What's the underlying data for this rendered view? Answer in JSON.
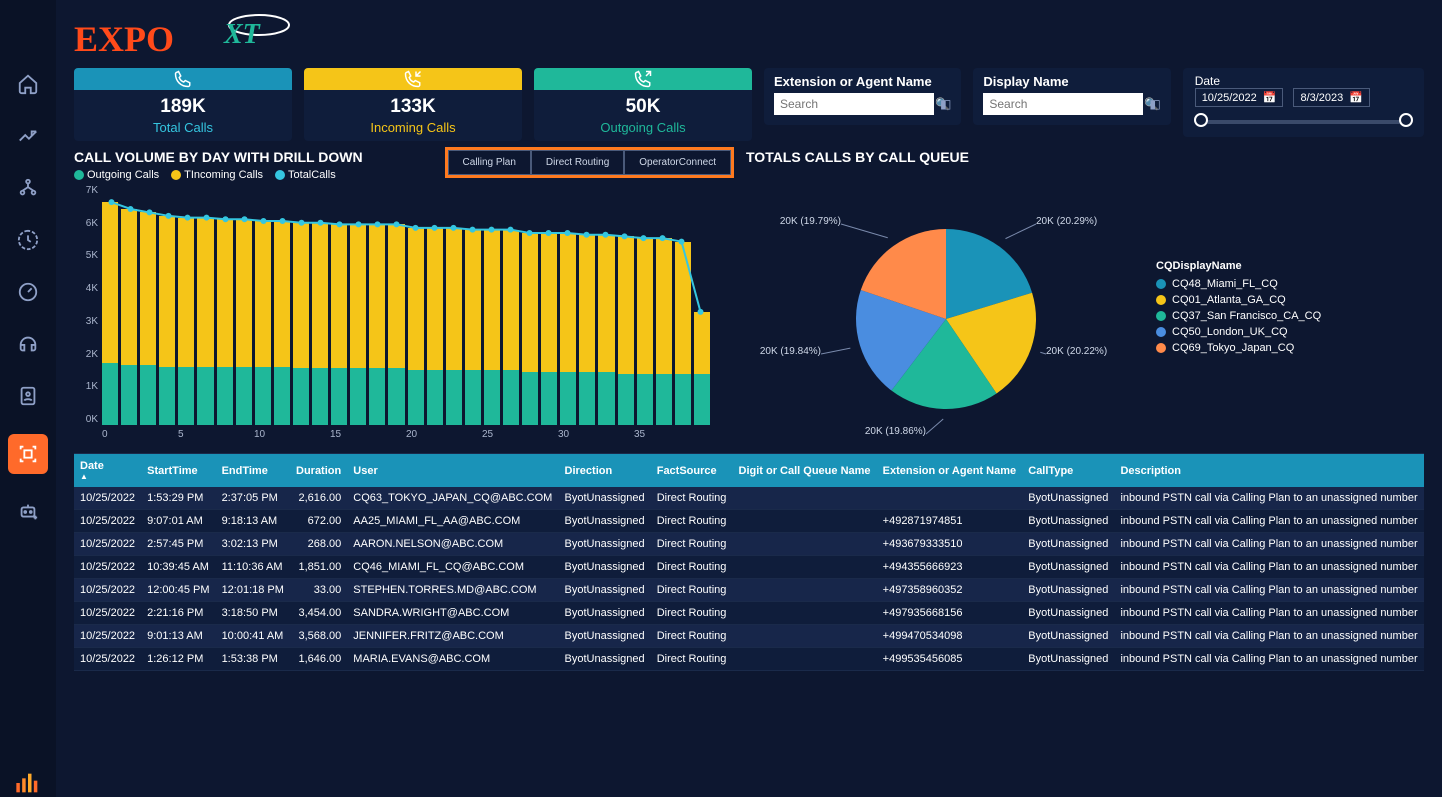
{
  "logo": {
    "text1": "EXPO",
    "text2": "XT"
  },
  "nav_items": [
    "home",
    "trend",
    "org",
    "time",
    "gauge",
    "headset",
    "contact",
    "scan",
    "bot-add"
  ],
  "kpis": [
    {
      "value": "189K",
      "label": "Total Calls",
      "color_bar": "#1a93b8",
      "color_lbl": "#35c6e0",
      "icon": "phone"
    },
    {
      "value": "133K",
      "label": "Incoming Calls",
      "color_bar": "#f5c518",
      "color_lbl": "#f5c518",
      "icon": "phone-in"
    },
    {
      "value": "50K",
      "label": "Outgoing Calls",
      "color_bar": "#1fb89a",
      "color_lbl": "#1fb89a",
      "icon": "phone-out"
    }
  ],
  "filters": {
    "ext": {
      "label": "Extension or Agent Name",
      "placeholder": "Search"
    },
    "disp": {
      "label": "Display Name",
      "placeholder": "Search"
    },
    "date": {
      "label": "Date",
      "from": "10/25/2022",
      "to": "8/3/2023"
    }
  },
  "bar_panel": {
    "title": "CALL VOLUME BY DAY WITH DRILL DOWN",
    "tabs": [
      "Calling Plan",
      "Direct Routing",
      "OperatorConnect"
    ],
    "legend": [
      {
        "name": "Outgoing Calls",
        "color": "#1fb89a"
      },
      {
        "name": "TIncoming Calls",
        "color": "#f5c518"
      },
      {
        "name": "TotalCalls",
        "color": "#35c6e0"
      }
    ],
    "y_ticks": [
      "7K",
      "6K",
      "5K",
      "4K",
      "3K",
      "2K",
      "1K",
      "0K"
    ],
    "x_ticks": [
      "0",
      "5",
      "10",
      "15",
      "20",
      "25",
      "30",
      "35"
    ]
  },
  "chart_data": {
    "type": "bar",
    "title": "CALL VOLUME BY DAY WITH DRILL DOWN",
    "xlabel": "",
    "ylabel": "",
    "ylim": [
      0,
      7000
    ],
    "x": [
      1,
      2,
      3,
      4,
      5,
      6,
      7,
      8,
      9,
      10,
      11,
      12,
      13,
      14,
      15,
      16,
      17,
      18,
      19,
      20,
      21,
      22,
      23,
      24,
      25,
      26,
      27,
      28,
      29,
      30,
      31,
      32
    ],
    "series": [
      {
        "name": "Outgoing Calls",
        "type": "bar",
        "color": "#1fb89a",
        "values": [
          1800,
          1750,
          1750,
          1700,
          1700,
          1700,
          1700,
          1700,
          1700,
          1700,
          1650,
          1650,
          1650,
          1650,
          1650,
          1650,
          1600,
          1600,
          1600,
          1600,
          1600,
          1600,
          1550,
          1550,
          1550,
          1550,
          1550,
          1500,
          1500,
          1500,
          1500,
          1500
        ]
      },
      {
        "name": "TIncoming Calls",
        "type": "bar",
        "color": "#f5c518",
        "values": [
          4700,
          4550,
          4450,
          4400,
          4350,
          4350,
          4300,
          4300,
          4250,
          4250,
          4250,
          4250,
          4200,
          4200,
          4200,
          4200,
          4150,
          4150,
          4150,
          4100,
          4100,
          4100,
          4050,
          4050,
          4050,
          4000,
          4000,
          4000,
          3950,
          3950,
          3850,
          1800
        ]
      },
      {
        "name": "TotalCalls",
        "type": "line",
        "color": "#35c6e0",
        "values": [
          6500,
          6300,
          6200,
          6100,
          6050,
          6050,
          6000,
          6000,
          5950,
          5950,
          5900,
          5900,
          5850,
          5850,
          5850,
          5850,
          5750,
          5750,
          5750,
          5700,
          5700,
          5700,
          5600,
          5600,
          5600,
          5550,
          5550,
          5500,
          5450,
          5450,
          5350,
          3300
        ]
      }
    ]
  },
  "pie_panel": {
    "title": "TOTALS CALLS BY CALL QUEUE",
    "legend_title": "CQDisplayName",
    "slices": [
      {
        "name": "CQ48_Miami_FL_CQ",
        "label": "20K (20.29%)",
        "pct": 20.29,
        "color": "#1a93b8"
      },
      {
        "name": "CQ01_Atlanta_GA_CQ",
        "label": "20K (20.22%)",
        "pct": 20.22,
        "color": "#f5c518"
      },
      {
        "name": "CQ37_San Francisco_CA_CQ",
        "label": "20K (19.86%)",
        "pct": 19.86,
        "color": "#1fb89a"
      },
      {
        "name": "CQ50_London_UK_CQ",
        "label": "20K (19.84%)",
        "pct": 19.84,
        "color": "#4a8de0"
      },
      {
        "name": "CQ69_Tokyo_Japan_CQ",
        "label": "20K (19.79%)",
        "pct": 19.79,
        "color": "#ff8a4a"
      }
    ]
  },
  "table": {
    "headers": [
      "Date",
      "StartTime",
      "EndTime",
      "Duration",
      "User",
      "Direction",
      "FactSource",
      "Digit or Call Queue Name",
      "Extension or Agent Name",
      "CallType",
      "Description"
    ],
    "rows": [
      [
        "10/25/2022",
        "1:53:29 PM",
        "2:37:05 PM",
        "2,616.00",
        "CQ63_TOKYO_JAPAN_CQ@ABC.COM",
        "ByotUnassigned",
        "Direct Routing",
        "",
        "",
        "ByotUnassigned",
        "inbound PSTN call via Calling Plan to an unassigned number"
      ],
      [
        "10/25/2022",
        "9:07:01 AM",
        "9:18:13 AM",
        "672.00",
        "AA25_MIAMI_FL_AA@ABC.COM",
        "ByotUnassigned",
        "Direct Routing",
        "",
        "+492871974851",
        "ByotUnassigned",
        "inbound PSTN call via Calling Plan to an unassigned number"
      ],
      [
        "10/25/2022",
        "2:57:45 PM",
        "3:02:13 PM",
        "268.00",
        "AARON.NELSON@ABC.COM",
        "ByotUnassigned",
        "Direct Routing",
        "",
        "+493679333510",
        "ByotUnassigned",
        "inbound PSTN call via Calling Plan to an unassigned number"
      ],
      [
        "10/25/2022",
        "10:39:45 AM",
        "11:10:36 AM",
        "1,851.00",
        "CQ46_MIAMI_FL_CQ@ABC.COM",
        "ByotUnassigned",
        "Direct Routing",
        "",
        "+494355666923",
        "ByotUnassigned",
        "inbound PSTN call via Calling Plan to an unassigned number"
      ],
      [
        "10/25/2022",
        "12:00:45 PM",
        "12:01:18 PM",
        "33.00",
        "STEPHEN.TORRES.MD@ABC.COM",
        "ByotUnassigned",
        "Direct Routing",
        "",
        "+497358960352",
        "ByotUnassigned",
        "inbound PSTN call via Calling Plan to an unassigned number"
      ],
      [
        "10/25/2022",
        "2:21:16 PM",
        "3:18:50 PM",
        "3,454.00",
        "SANDRA.WRIGHT@ABC.COM",
        "ByotUnassigned",
        "Direct Routing",
        "",
        "+497935668156",
        "ByotUnassigned",
        "inbound PSTN call via Calling Plan to an unassigned number"
      ],
      [
        "10/25/2022",
        "9:01:13 AM",
        "10:00:41 AM",
        "3,568.00",
        "JENNIFER.FRITZ@ABC.COM",
        "ByotUnassigned",
        "Direct Routing",
        "",
        "+499470534098",
        "ByotUnassigned",
        "inbound PSTN call via Calling Plan to an unassigned number"
      ],
      [
        "10/25/2022",
        "1:26:12 PM",
        "1:53:38 PM",
        "1,646.00",
        "MARIA.EVANS@ABC.COM",
        "ByotUnassigned",
        "Direct Routing",
        "",
        "+499535456085",
        "ByotUnassigned",
        "inbound PSTN call via Calling Plan to an unassigned number"
      ]
    ]
  }
}
